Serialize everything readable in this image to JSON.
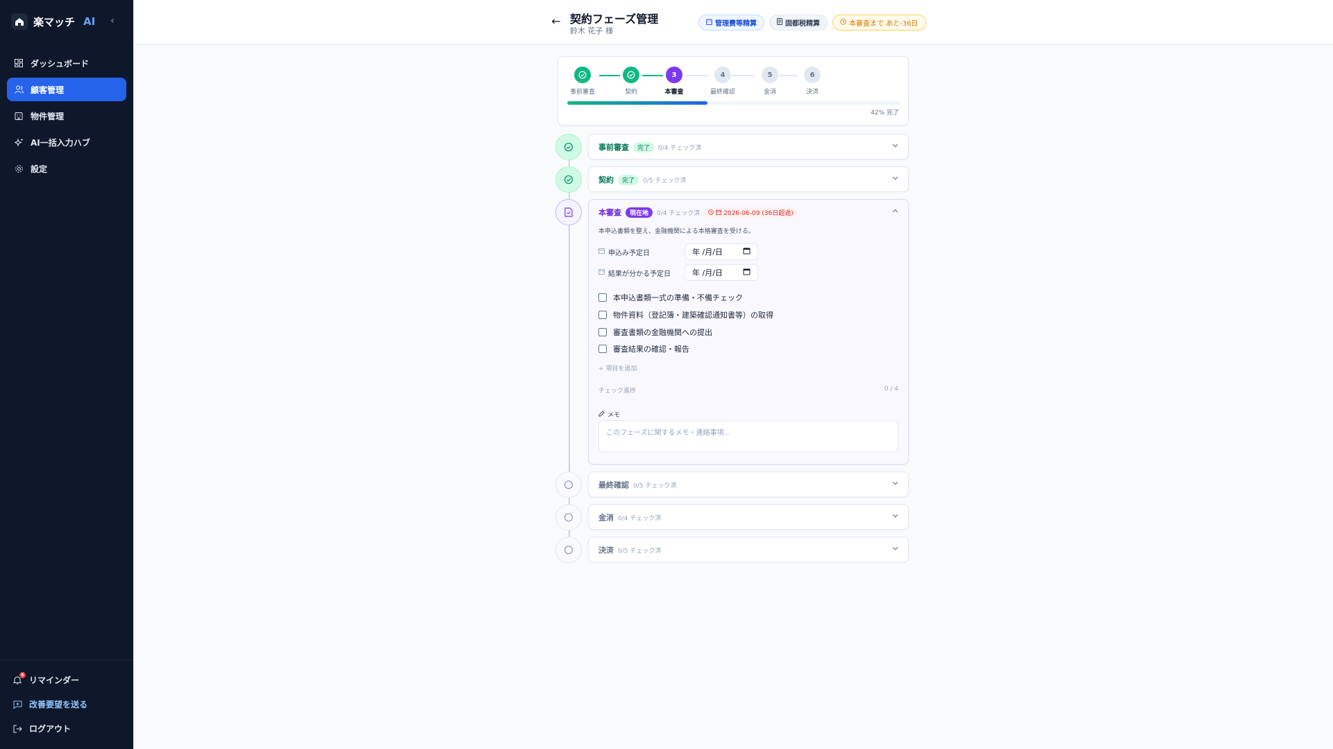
{
  "sidebar": {
    "brand": {
      "name": "楽マッチ",
      "suffix": "AI"
    },
    "collapse_icon": "chevron-left-icon",
    "nav": [
      {
        "label": "ダッシュボード",
        "icon": "grid-icon",
        "active": false
      },
      {
        "label": "顧客管理",
        "icon": "users-icon",
        "active": true
      },
      {
        "label": "物件管理",
        "icon": "building-icon",
        "active": false
      },
      {
        "label": "AI一括入力ハブ",
        "icon": "sparkles-icon",
        "active": false
      },
      {
        "label": "設定",
        "icon": "gear-icon",
        "active": false
      }
    ],
    "bottom": [
      {
        "label": "リマインダー",
        "icon": "bell-icon",
        "badge": "6"
      },
      {
        "label": "改善要望を送る",
        "icon": "message-square-icon"
      },
      {
        "label": "ログアウト",
        "icon": "logout-icon"
      }
    ]
  },
  "header": {
    "title": "契約フェーズ管理",
    "subtitle": "鈴木 花子 様",
    "buttons": [
      {
        "label": "管理費等精算",
        "icon": "building-icon"
      },
      {
        "label": "固都税精算",
        "icon": "document-icon"
      },
      {
        "label": "本審査まで あと-36日",
        "icon": "clock-icon"
      }
    ]
  },
  "stepper": {
    "steps": [
      {
        "number": "1",
        "label": "事前審査",
        "status": "done"
      },
      {
        "number": "2",
        "label": "契約",
        "status": "done"
      },
      {
        "number": "3",
        "label": "本審査",
        "status": "current"
      },
      {
        "number": "4",
        "label": "最終確認",
        "status": "todo"
      },
      {
        "number": "5",
        "label": "金消",
        "status": "todo"
      },
      {
        "number": "6",
        "label": "決済",
        "status": "todo"
      }
    ],
    "progress_percent": 42,
    "progress_text": "42% 完了"
  },
  "phases": [
    {
      "title": "事前審査",
      "badge": "完了",
      "count": "0/4 チェック済",
      "status": "done"
    },
    {
      "title": "契約",
      "badge": "完了",
      "count": "0/5 チェック済",
      "status": "done"
    },
    {
      "title": "本審査",
      "badge": "現在地",
      "count": "0/4 チェック済",
      "deadline": "2026-06-09 (36日超過)",
      "status": "current",
      "description": "本申込書類を整え、金融機関による本格審査を受ける。",
      "dates": [
        {
          "label": "申込み予定日",
          "value": "年 /月/日"
        },
        {
          "label": "結果が分かる予定日",
          "value": "年 /月/日"
        }
      ],
      "checklist": [
        "本申込書類一式の準備・不備チェック",
        "物件資料（登記簿・建築確認通知書等）の取得",
        "審査書類の金融機関への提出",
        "審査結果の確認・報告"
      ],
      "add_item": "+ 項目を追加",
      "check_progress_label": "チェック進捗",
      "check_progress_value": "0 / 4",
      "memo_label": "メモ",
      "memo_placeholder": "このフェーズに関するメモ・連絡事項..."
    },
    {
      "title": "最終確認",
      "count": "0/5 チェック済",
      "status": "todo"
    },
    {
      "title": "金消",
      "count": "0/4 チェック済",
      "status": "todo"
    },
    {
      "title": "決済",
      "count": "0/5 チェック済",
      "status": "todo"
    }
  ],
  "colors": {
    "sidebar_bg": "#0f172a",
    "accent_blue": "#2563eb",
    "done_green": "#10b981",
    "current_purple": "#7c3aed",
    "deadline_red": "#dc2626",
    "warning_amber": "#d97706"
  }
}
